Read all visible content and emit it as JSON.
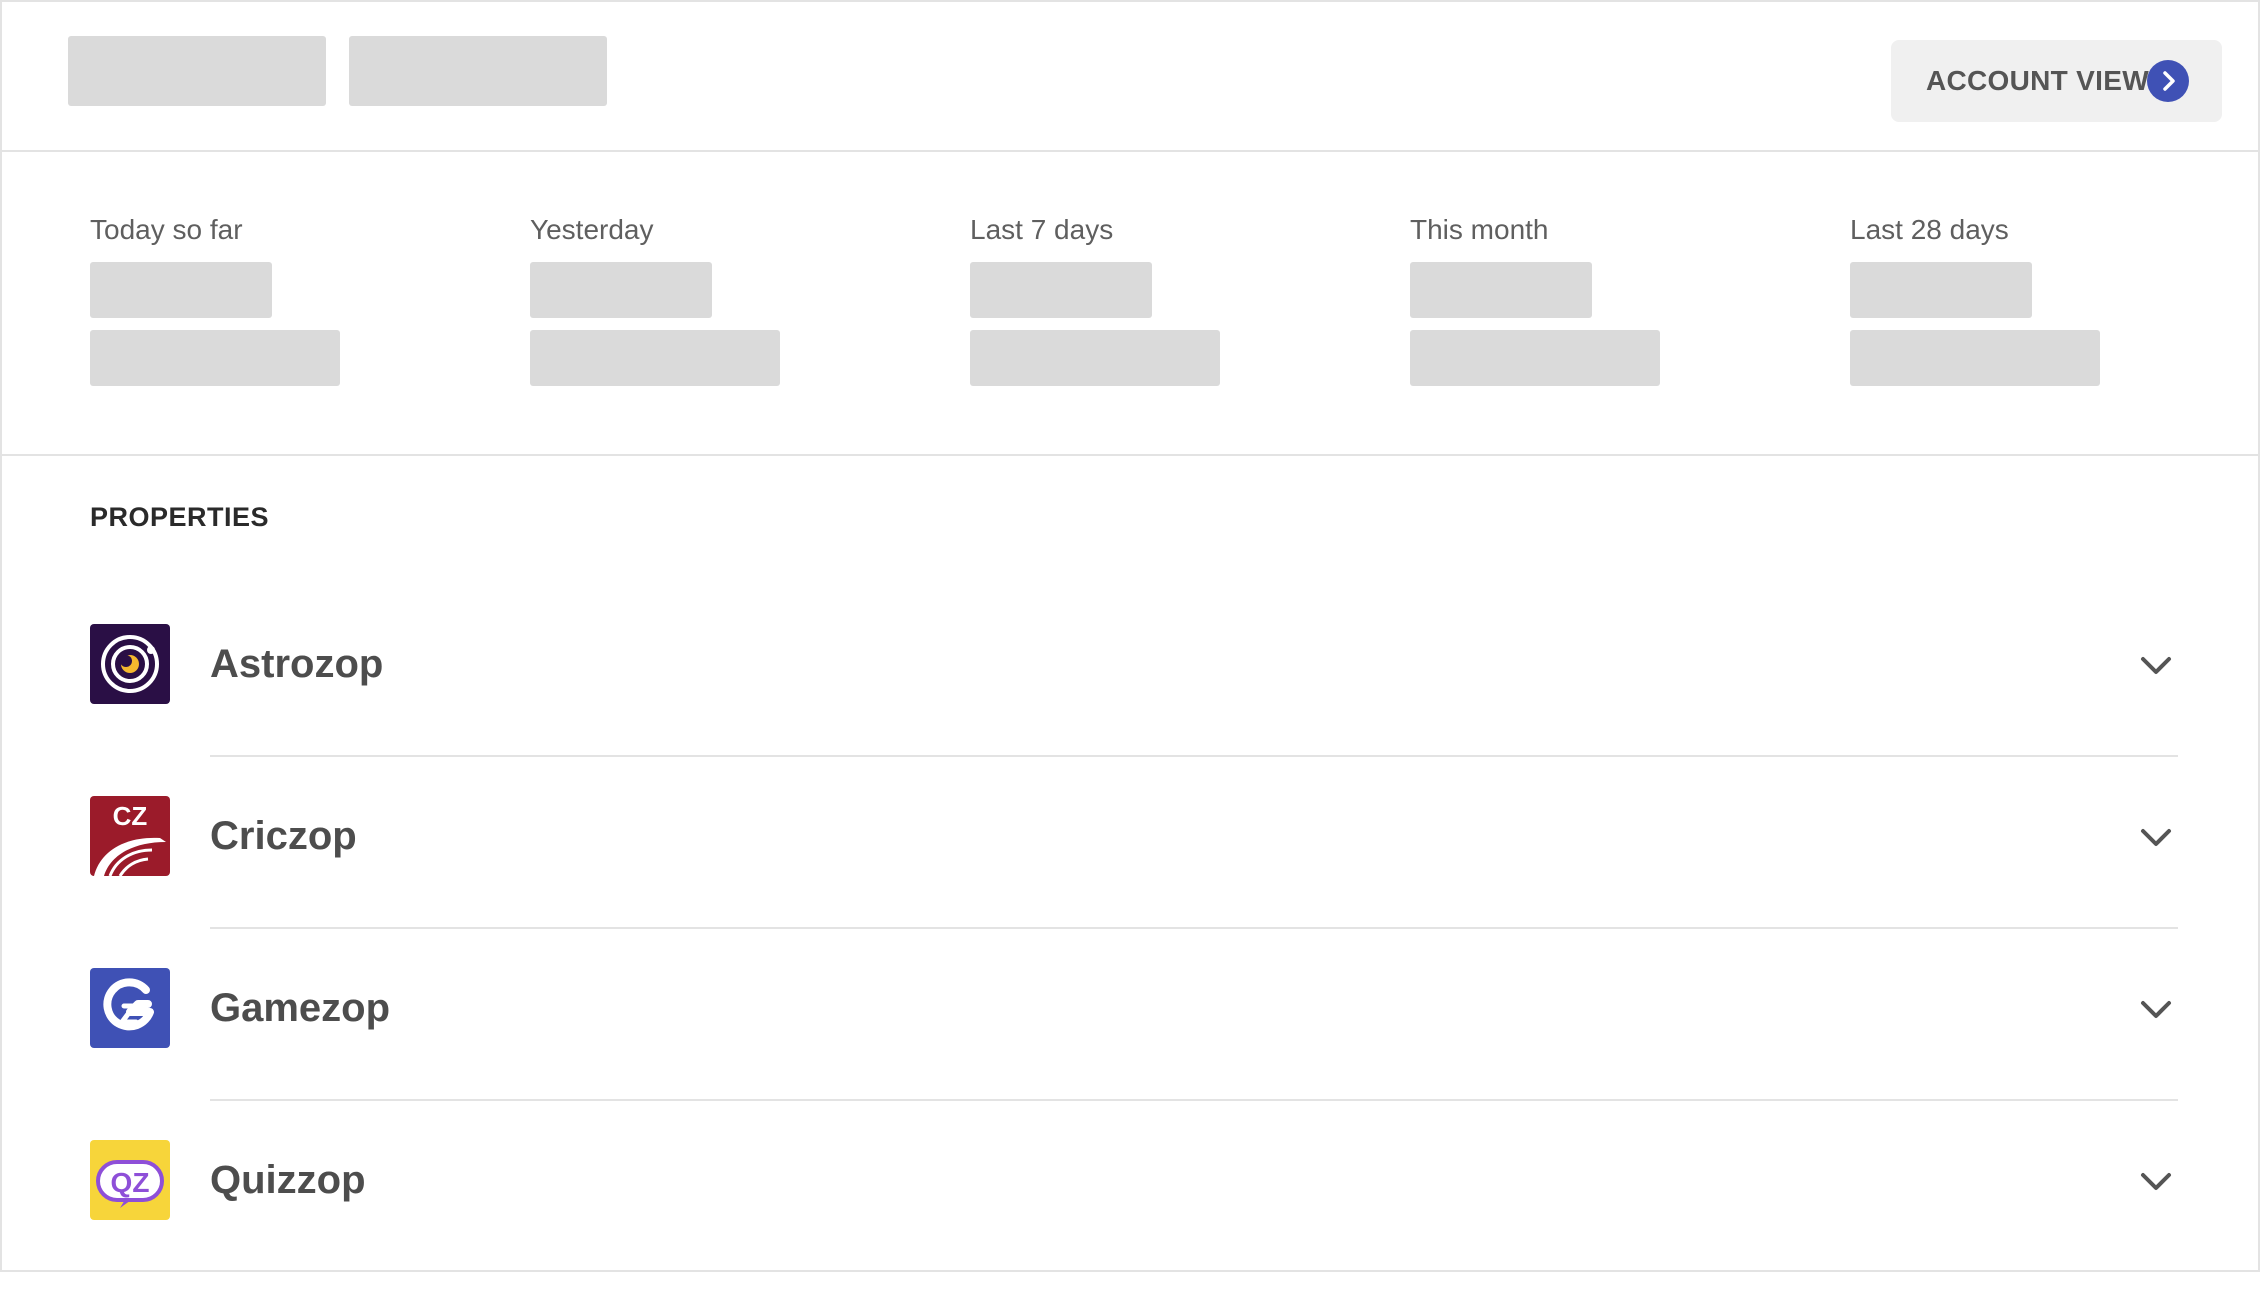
{
  "header": {
    "account_button_label": "ACCOUNT VIEW"
  },
  "stats": [
    {
      "label": "Today so far"
    },
    {
      "label": "Yesterday"
    },
    {
      "label": "Last 7 days"
    },
    {
      "label": "This month"
    },
    {
      "label": "Last 28 days"
    }
  ],
  "properties": {
    "title": "PROPERTIES",
    "items": [
      {
        "name": "Astrozop",
        "icon": "astrozop-logo-icon"
      },
      {
        "name": "Criczop",
        "icon": "criczop-logo-icon",
        "logo_text": "CZ"
      },
      {
        "name": "Gamezop",
        "icon": "gamezop-logo-icon"
      },
      {
        "name": "Quizzop",
        "icon": "quizzop-logo-icon",
        "logo_text": "QZ"
      }
    ]
  },
  "colors": {
    "accent": "#3f51b5",
    "skeleton": "#dadada",
    "astrozop": "#2a0f45",
    "criczop": "#9b1b2a",
    "gamezop": "#3f51b5",
    "quizzop": "#f7d53a"
  }
}
